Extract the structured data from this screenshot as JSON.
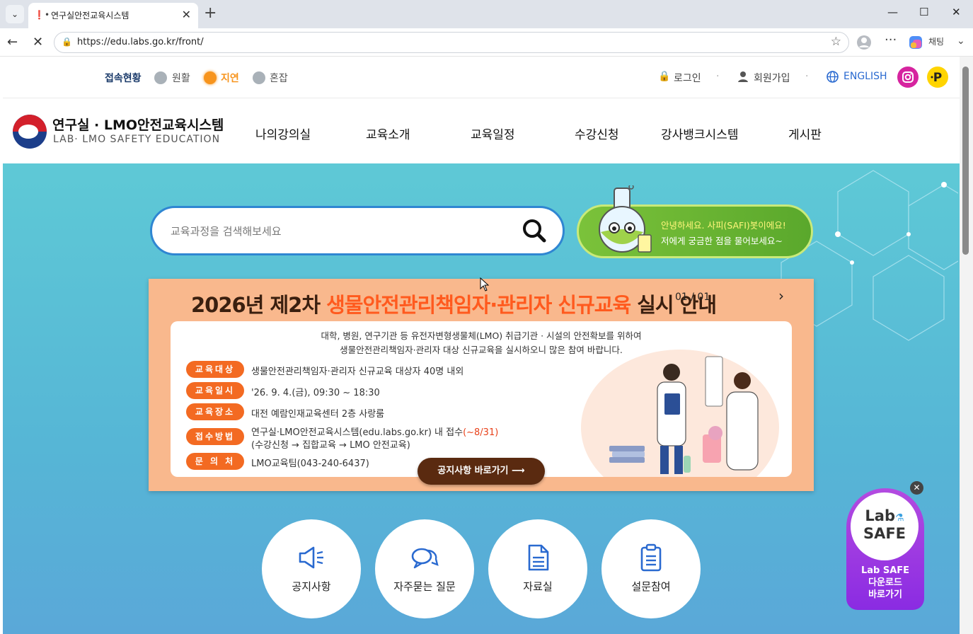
{
  "browser": {
    "tab_title": "연구실안전교육시스템",
    "url": "https://edu.labs.go.kr/front/",
    "copilot_label": "채팅"
  },
  "status": {
    "label": "접속현황",
    "items": [
      {
        "label": "원활",
        "color": "#a9b1b8"
      },
      {
        "label": "지연",
        "color": "#f7941d"
      },
      {
        "label": "혼잡",
        "color": "#a9b1b8"
      }
    ]
  },
  "util": {
    "login": "로그인",
    "signup": "회원가입",
    "english": "ENGLISH"
  },
  "logo": {
    "title": "연구실 · LMO안전교육시스템",
    "subtitle": "LAB· LMO SAFETY EDUCATION"
  },
  "nav": [
    "나의강의실",
    "교육소개",
    "교육일정",
    "수강신청",
    "강사뱅크시스템",
    "게시판"
  ],
  "search": {
    "placeholder": "교육과정을 검색해보세요"
  },
  "chatbot": {
    "line1": "안녕하세요. 사피(SAFI)봇이에요!",
    "line2": "저에게 궁금한 점을 물어보세요~"
  },
  "banner": {
    "headline_pre": "2026년 제2차 ",
    "headline_hl": "생물안전관리책임자·관리자 신규교육",
    "headline_post": " 실시 안내",
    "pager": "01 / 01",
    "intro1": "대학, 병원, 연구기관 등 유전자변형생물체(LMO) 취급기관 · 시설의 안전확보를 위하여",
    "intro2": "생물안전관리책임자·관리자 대상 신규교육을 실시하오니 많은 참여 바랍니다.",
    "rows": [
      {
        "label": "교육대상",
        "value": "생물안전관리책임자·관리자 신규교육 대상자 40명 내외"
      },
      {
        "label": "교육일시",
        "value": "'26. 9. 4.(금), 09:30 ~ 18:30"
      },
      {
        "label": "교육장소",
        "value": "대전 예람인재교육센터 2층 사랑룸"
      },
      {
        "label": "접수방법",
        "value": "연구실·LMO안전교육시스템(edu.labs.go.kr) 내 접수",
        "value_hl": "(~8/31)",
        "value2": "(수강신청 → 집합교육 → LMO 안전교육)"
      },
      {
        "label": "문 의 처",
        "value": "LMO교육팀(043-240-6437)"
      }
    ],
    "cta": "공지사항 바로가기"
  },
  "quick_links": [
    {
      "label": "공지사항",
      "icon": "megaphone-icon"
    },
    {
      "label": "자주묻는 질문",
      "icon": "chat-bubbles-icon"
    },
    {
      "label": "자료실",
      "icon": "document-icon"
    },
    {
      "label": "설문참여",
      "icon": "clipboard-icon"
    }
  ],
  "labsafe": {
    "logo1": "Lab",
    "logo2": "SAFE",
    "line1": "Lab SAFE",
    "line2": "다운로드",
    "line3": "바로가기"
  }
}
